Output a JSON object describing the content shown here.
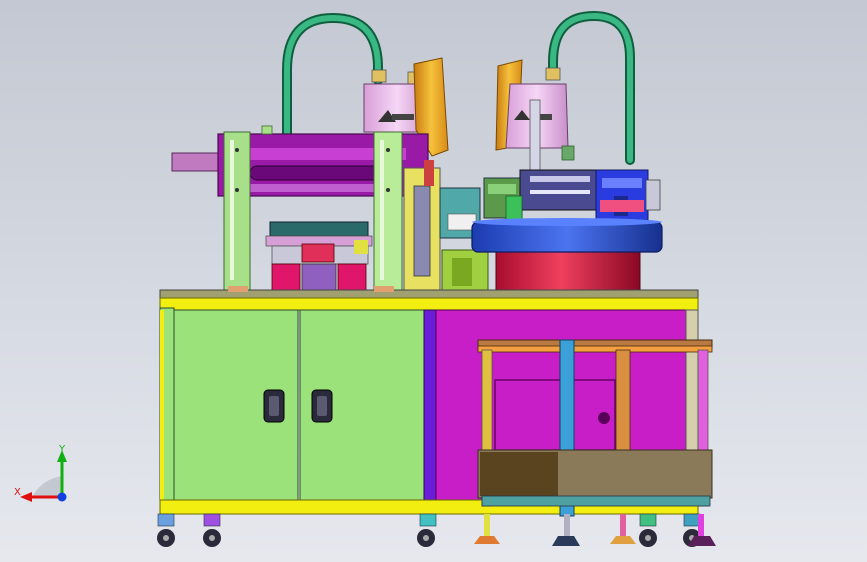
{
  "viewport": {
    "background_top": "#c3c8d2",
    "background_bottom": "#e6e8ee"
  },
  "axis_triad": {
    "x_label": "X",
    "y_label": "Y",
    "x_color": "#e01010",
    "y_color": "#10b010",
    "z_color": "#1040e0"
  },
  "colors": {
    "frame_yellow": "#f2ee10",
    "cabinet_green": "#9be27a",
    "cabinet_magenta": "#c81ec8",
    "bowl_red": "#e0244a",
    "bowl_blue": "#2a52d8",
    "robot_pink": "#e8b8e8",
    "hose_green": "#1e8a5e",
    "handle_dark": "#2a2a3a"
  }
}
